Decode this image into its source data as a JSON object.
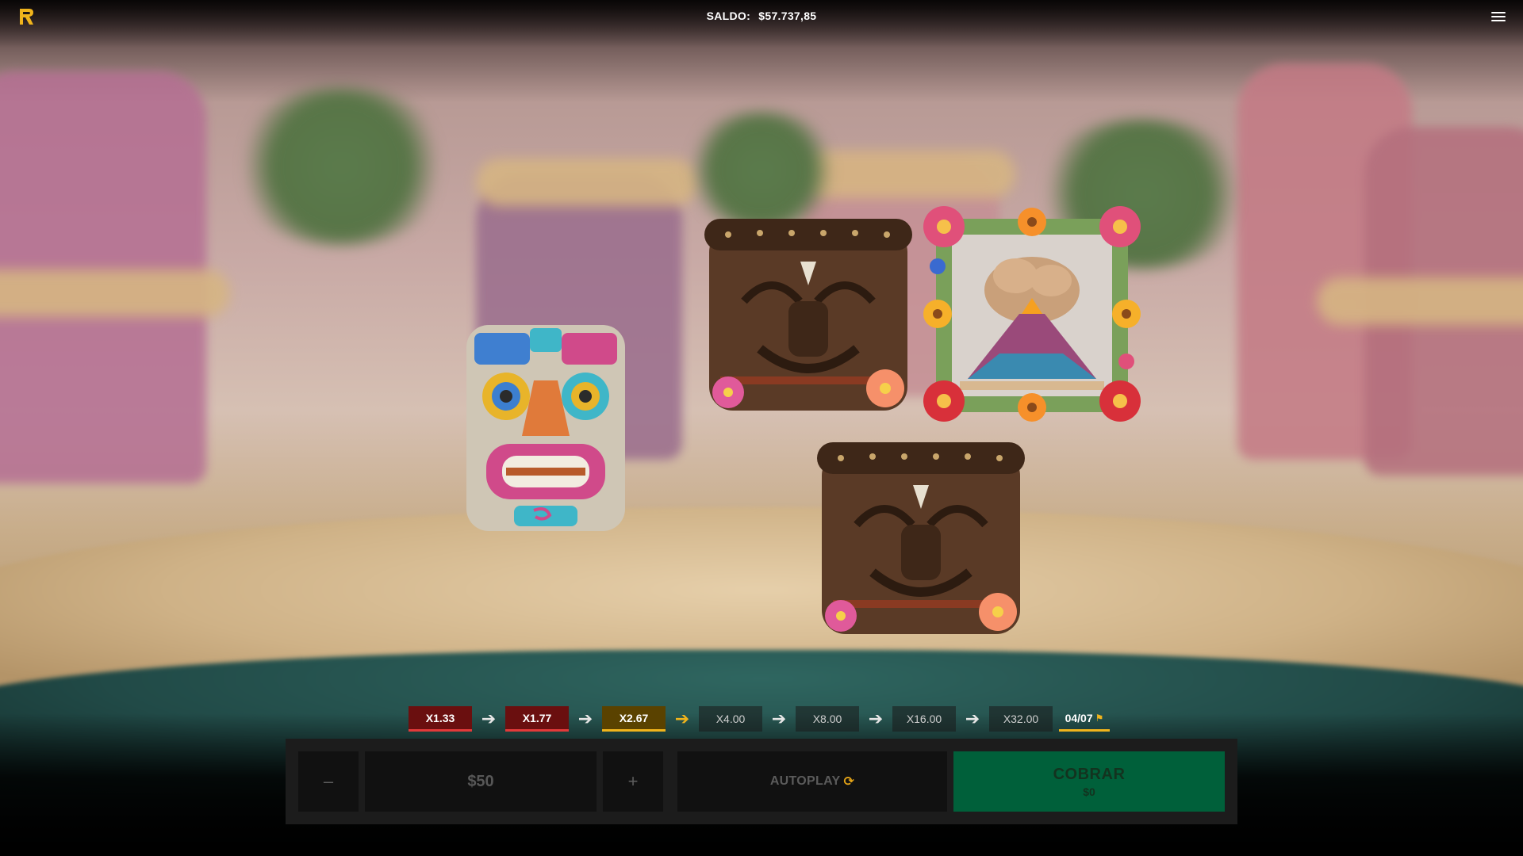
{
  "header": {
    "balance_label": "SALDO:",
    "balance_value": "$57.737,85"
  },
  "symbols": [
    {
      "name": "tiki-mask-colorful"
    },
    {
      "name": "tiki-drum-wood"
    },
    {
      "name": "volcano-flower-frame"
    },
    {
      "name": "tiki-drum-wood"
    }
  ],
  "track": {
    "multipliers": [
      {
        "label": "X1.33",
        "state": "done"
      },
      {
        "label": "X1.77",
        "state": "done"
      },
      {
        "label": "X2.67",
        "state": "current"
      },
      {
        "label": "X4.00",
        "state": "future"
      },
      {
        "label": "X8.00",
        "state": "future"
      },
      {
        "label": "X16.00",
        "state": "future"
      },
      {
        "label": "X32.00",
        "state": "future"
      }
    ],
    "progress": "04/07",
    "arrow_icon": "arrow-right-icon",
    "flag_icon": "checkered-flag-icon"
  },
  "controls": {
    "minus_label": "–",
    "bet_value": "$50",
    "plus_label": "+",
    "autoplay_label": "AUTOPLAY",
    "autoplay_icon": "refresh-icon",
    "cashout_label": "COBRAR",
    "cashout_value": "$0"
  },
  "colors": {
    "done": "#6a0f0f",
    "done_accent": "#e23a3a",
    "current": "#5a4200",
    "accent_gold": "#f0b41c",
    "cashout": "#00603a",
    "panel": "#1c1c1c"
  }
}
